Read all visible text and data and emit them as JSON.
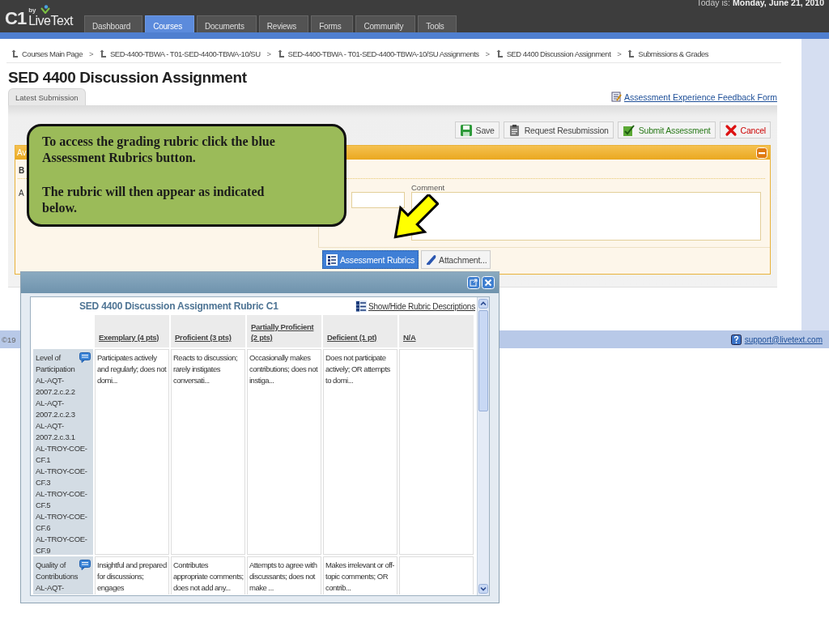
{
  "header": {
    "logo": {
      "mark": "C1",
      "by": "by",
      "name": "LiveText"
    },
    "date_label": "Today is:",
    "date": "Monday, June 21, 2010"
  },
  "nav_tabs": [
    {
      "label": "Dashboard",
      "selected": false
    },
    {
      "label": "Courses",
      "selected": true
    },
    {
      "label": "Documents",
      "selected": false
    },
    {
      "label": "Reviews",
      "selected": false
    },
    {
      "label": "Forms",
      "selected": false
    },
    {
      "label": "Community",
      "selected": false
    },
    {
      "label": "Tools",
      "selected": false
    }
  ],
  "breadcrumb": {
    "separator": ">",
    "items": [
      "Courses Main Page",
      "SED-4400-TBWA - T01-SED-4400-TBWA-10/SU",
      "SED-4400-TBWA - T01-SED-4400-TBWA-10/SU Assignments",
      "SED 4400 Discussion Assignment",
      "Submissions & Grades"
    ]
  },
  "page_title": "SED 4400 Discussion Assignment",
  "tabs": [
    {
      "label": "Latest Submission",
      "selected": true
    }
  ],
  "feedback_link": "Assessment Experience Feedback Form",
  "actions": [
    {
      "label": "Save",
      "kind": "save"
    },
    {
      "label": "Request Resubmission",
      "kind": "resubmit"
    },
    {
      "label": "Submit Assessment",
      "kind": "submit"
    },
    {
      "label": "Cancel",
      "kind": "cancel"
    }
  ],
  "assessment_panel": {
    "header": "Av",
    "section_label": "B",
    "field_label": "A",
    "comment_label": "Comment",
    "buttons": [
      {
        "label": "Assessment Rubrics",
        "selected": true
      },
      {
        "label": "Attachment...",
        "selected": false
      }
    ]
  },
  "footer": {
    "copyright": "©19",
    "support": "support@livetext.com"
  },
  "callout": {
    "paragraphs": [
      "To access the grading rubric click the blue Assessment Rubrics button.",
      "The rubric will then appear as indicated below."
    ]
  },
  "rubric_window": {
    "title": "SED 4400 Discussion Assignment Rubric C1",
    "toggle_link": "Show/Hide Rubric Descriptions",
    "columns": [
      "Exemplary (4 pts)",
      "Proficient (3 pts)",
      "Partially Proficient (2 pts)",
      "Deficient (1 pt)",
      "N/A"
    ],
    "rows": [
      {
        "criterion": "Level of Participation",
        "standards": [
          "AL-AQT-2007.2.c.2.2",
          "AL-AQT-2007.2.c.2.3",
          "AL-AQT-2007.2.c.3.1",
          "AL-TROY-COE-CF.1",
          "AL-TROY-COE-CF.3",
          "AL-TROY-COE-CF.5",
          "AL-TROY-COE-CF.6",
          "AL-TROY-COE-CF.9"
        ],
        "cells": [
          "Participates actively and regularly; does not domi...",
          "Reacts to discussion; rarely instigates conversati...",
          "Occasionally makes contributions; does not instiga...",
          "Does not participate actively; OR attempts to domi..."
        ]
      },
      {
        "criterion": "Quality of Contributions",
        "standards": [
          "AL-AQT-"
        ],
        "cells": [
          "Insightful and prepared for discussions; engages",
          "Contributes appropriate comments; does not add any...",
          "Attempts to agree with discussants; does not make ...",
          "Makes irrelevant or off-topic comments; OR contrib..."
        ]
      }
    ]
  }
}
